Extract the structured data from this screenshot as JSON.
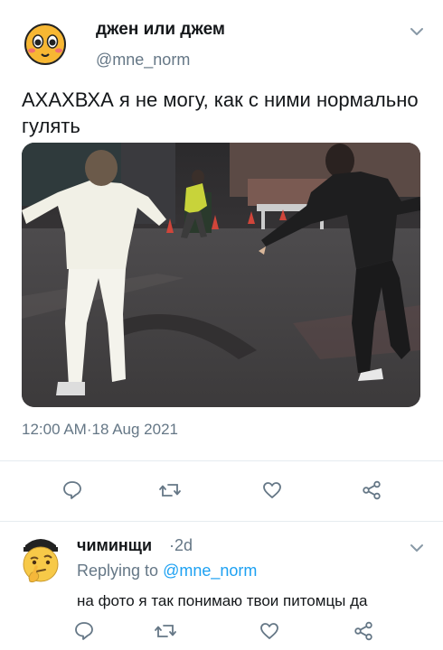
{
  "tweet": {
    "author_name": "джен или джем",
    "author_handle": "@mne_norm",
    "text": "АХАХВХА я не могу, как с ними нормально гулять",
    "timestamp_time": "12:00 AM",
    "timestamp_sep": "·",
    "timestamp_date": "18 Aug 2021",
    "avatar_icon": "smiling-face-emoji-icon",
    "media_icon": "photo-people-walking-street"
  },
  "reply": {
    "author_name": "чиминщи",
    "time": "·2d",
    "replying_label": "Replying to",
    "replying_mention": "@mne_norm",
    "text": "на фото я так понимаю твои питомцы да",
    "avatar_icon": "thinking-face-emoji-icon"
  },
  "actions": [
    "reply-icon",
    "retweet-icon",
    "like-icon",
    "share-icon"
  ],
  "colors": {
    "text": "#14171a",
    "muted": "#657786",
    "link": "#1da1f2",
    "divider": "#e6ecf0"
  }
}
